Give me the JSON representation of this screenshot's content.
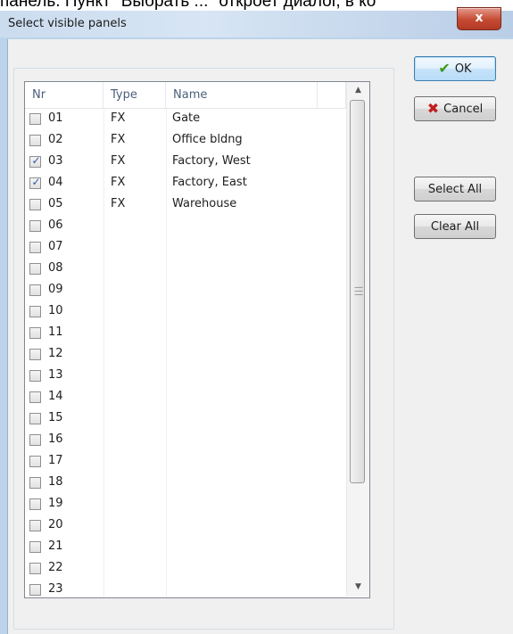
{
  "top_caption": "панель. Пункт \"Выбрать ...\" откроет диалог, в ко",
  "window": {
    "title": "Select visible panels",
    "close_glyph": "x"
  },
  "buttons": {
    "ok": {
      "label": "OK",
      "icon": "checkmark-icon"
    },
    "cancel": {
      "label": "Cancel",
      "icon": "red-x-icon"
    },
    "select_all": "Select All",
    "clear_all": "Clear All"
  },
  "list": {
    "columns": [
      "Nr",
      "Type",
      "Name"
    ],
    "rows": [
      {
        "nr": "01",
        "type": "FX",
        "name": "Gate",
        "checked": false
      },
      {
        "nr": "02",
        "type": "FX",
        "name": "Office bldng",
        "checked": false
      },
      {
        "nr": "03",
        "type": "FX",
        "name": "Factory, West",
        "checked": true
      },
      {
        "nr": "04",
        "type": "FX",
        "name": "Factory, East",
        "checked": true
      },
      {
        "nr": "05",
        "type": "FX",
        "name": "Warehouse",
        "checked": false
      },
      {
        "nr": "06",
        "type": "",
        "name": "",
        "checked": false
      },
      {
        "nr": "07",
        "type": "",
        "name": "",
        "checked": false
      },
      {
        "nr": "08",
        "type": "",
        "name": "",
        "checked": false
      },
      {
        "nr": "09",
        "type": "",
        "name": "",
        "checked": false
      },
      {
        "nr": "10",
        "type": "",
        "name": "",
        "checked": false
      },
      {
        "nr": "11",
        "type": "",
        "name": "",
        "checked": false
      },
      {
        "nr": "12",
        "type": "",
        "name": "",
        "checked": false
      },
      {
        "nr": "13",
        "type": "",
        "name": "",
        "checked": false
      },
      {
        "nr": "14",
        "type": "",
        "name": "",
        "checked": false
      },
      {
        "nr": "15",
        "type": "",
        "name": "",
        "checked": false
      },
      {
        "nr": "16",
        "type": "",
        "name": "",
        "checked": false
      },
      {
        "nr": "17",
        "type": "",
        "name": "",
        "checked": false
      },
      {
        "nr": "18",
        "type": "",
        "name": "",
        "checked": false
      },
      {
        "nr": "19",
        "type": "",
        "name": "",
        "checked": false
      },
      {
        "nr": "20",
        "type": "",
        "name": "",
        "checked": false
      },
      {
        "nr": "21",
        "type": "",
        "name": "",
        "checked": false
      },
      {
        "nr": "22",
        "type": "",
        "name": "",
        "checked": false
      },
      {
        "nr": "23",
        "type": "",
        "name": "",
        "checked": false
      }
    ]
  },
  "colors": {
    "check_tick": "#2c5aa0",
    "ok_check": "#3a9a1e",
    "cancel_x": "#c21e1e",
    "close_button": "#c54a33"
  }
}
